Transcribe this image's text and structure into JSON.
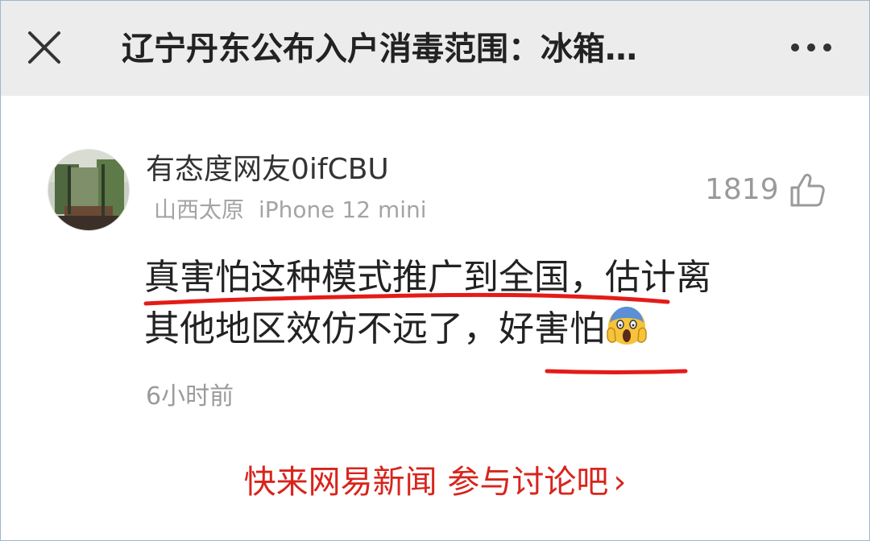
{
  "header": {
    "title": "辽宁丹东公布入户消毒范围：冰箱…",
    "close_icon": "close-icon",
    "more_icon": "more-dots-icon"
  },
  "comment": {
    "username": "有态度网友0ifCBU",
    "location": "山西太原",
    "device": "iPhone 12 mini",
    "likes": "1819",
    "like_icon": "thumbs-up-icon",
    "text_line1": "真害怕这种模式推广到全国，估计离",
    "text_line2": "其他地区效仿不远了，好害怕",
    "emoji": "screaming-face-emoji",
    "time": "6小时前"
  },
  "cta": {
    "label": "快来网易新闻 参与讨论吧",
    "chevron": "›"
  },
  "colors": {
    "accent": "#d8241c",
    "topbar": "#ececec",
    "annotation": "#e41b17"
  }
}
